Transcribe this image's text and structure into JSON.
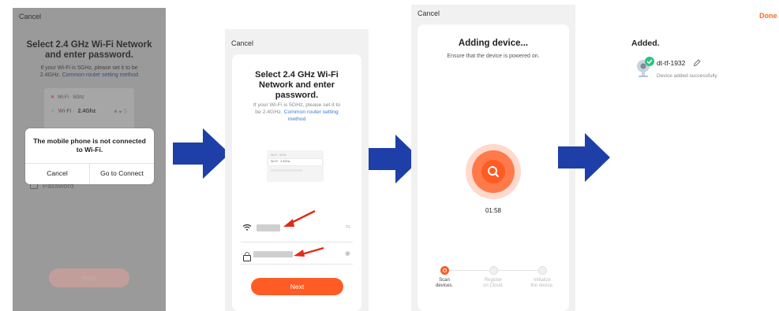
{
  "screen1": {
    "cancel": "Cancel",
    "title_line1": "Select 2.4 GHz Wi-Fi Network",
    "title_line2": "and enter password.",
    "hint_line1": "If your Wi-Fi is 5GHz, please set it to be",
    "hint_line2_prefix": "2.4GHz.",
    "hint_link": "Common router setting method",
    "wifi_5g": "Wi-Fi · 5Ghz",
    "wifi_24g_prefix": "Wi-Fi ·",
    "wifi_24g_band": "2.4Ghz",
    "password_label": "Password",
    "next_label": "Next",
    "dialog": {
      "message_line1": "The mobile phone is not connected",
      "message_line2": "to Wi-Fi.",
      "cancel_label": "Cancel",
      "connect_label": "Go to Connect"
    }
  },
  "screen2": {
    "cancel": "Cancel",
    "title_line1": "Select 2.4 GHz Wi-Fi",
    "title_line2": "Network and enter",
    "title_line3": "password.",
    "hint_line1": "If your Wi-Fi is 5GHz, please set it to",
    "hint_line2_prefix": "be 2.4GHz.",
    "hint_link_part1": "Common router setting",
    "hint_link_part2": "method",
    "mini_5g": "Wi-Fi · 5Ghz",
    "mini_24g": "Wi-Fi · 2.4Ghz",
    "next_label": "Next"
  },
  "screen3": {
    "cancel": "Cancel",
    "title": "Adding device...",
    "subtitle": "Ensure that the device is powered on.",
    "timer": "01:58",
    "steps": [
      {
        "line1": "Scan",
        "line2": "devices."
      },
      {
        "line1": "Register",
        "line2": "on Cloud."
      },
      {
        "line1": "Initialize",
        "line2": "the device."
      }
    ]
  },
  "screen4": {
    "done_label": "Done",
    "added_title": "Added.",
    "device_name": "dt-tf-1932",
    "device_status": "Device added successfully"
  },
  "colors": {
    "accent": "#ff5b24",
    "arrow": "#1f3fa8",
    "link": "#3a7bd5",
    "success": "#2ec27e"
  }
}
